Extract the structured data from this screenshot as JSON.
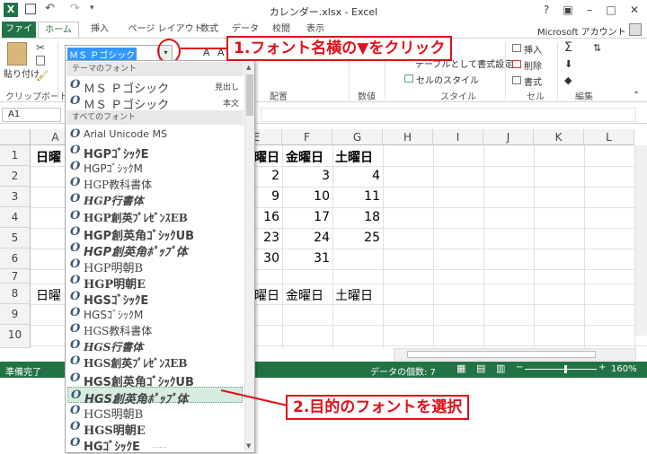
{
  "window": {
    "title": "カレンダー.xlsx - Excel",
    "controls": [
      "?",
      "▣",
      "–",
      "□",
      "✕"
    ]
  },
  "tabs": [
    "ファイル",
    "ホーム",
    "挿入",
    "ページ レイアウト",
    "数式",
    "データ",
    "校閲",
    "表示"
  ],
  "account": "Microsoft アカウント",
  "ribbon": {
    "paste_label": "貼り付け",
    "clipboard_label": "クリップボード",
    "font_box_value": "ＭＳ Ｐゴシック",
    "align_label": "配置",
    "number_label": "数値",
    "table_format": "テーブルとして書式設定",
    "cell_style": "セルのスタイル",
    "style_label": "スタイル",
    "insert": "挿入",
    "delete": "削除",
    "format": "書式",
    "cells_label": "セル",
    "edit_label": "編集"
  },
  "name_box": "A1",
  "columns": [
    "A",
    "B",
    "C",
    "D",
    "E",
    "F",
    "G",
    "H",
    "I",
    "J",
    "K",
    "L"
  ],
  "rows": [
    "1",
    "2",
    "3",
    "4",
    "5",
    "6",
    "7",
    "8",
    "9",
    "10"
  ],
  "cells": {
    "a1": "日曜",
    "e1": "曜日",
    "f1": "金曜日",
    "g1": "土曜日",
    "e2": "2",
    "f2": "3",
    "g2": "4",
    "e3": "9",
    "f3": "10",
    "g3": "11",
    "e4": "16",
    "f4": "17",
    "g4": "18",
    "e5": "23",
    "f5": "24",
    "g5": "25",
    "e6": "30",
    "f6": "31",
    "a8": "日曜",
    "e8": "曜日",
    "f8": "金曜日",
    "g8": "土曜日"
  },
  "dropdown": {
    "theme_header": "テーマのフォント",
    "theme_fonts": [
      {
        "name": "ＭＳ Ｐゴシック",
        "role": "見出し"
      },
      {
        "name": "ＭＳ Ｐゴシック",
        "role": "本文"
      }
    ],
    "all_header": "すべてのフォント",
    "fonts": [
      "Arial Unicode MS",
      "HGPｺﾞｼｯｸE",
      "HGPｺﾞｼｯｸM",
      "HGP教科書体",
      "HGP行書体",
      "HGP創英ﾌﾟﾚｾﾞﾝｽEB",
      "HGP創英角ｺﾞｼｯｸUB",
      "HGP創英角ﾎﾟｯﾌﾟ体",
      "HGP明朝B",
      "HGP明朝E",
      "HGSｺﾞｼｯｸE",
      "HGSｺﾞｼｯｸM",
      "HGS教科書体",
      "HGS行書体",
      "HGS創英ﾌﾟﾚｾﾞﾝｽEB",
      "HGS創英角ｺﾞｼｯｸUB",
      "HGS創英角ﾎﾟｯﾌﾟ体",
      "HGS明朝B",
      "HGS明朝E",
      "HGｺﾞｼｯｸE"
    ],
    "selected_index": 16
  },
  "status": {
    "ready": "準備完了",
    "count": "データの個数: 7",
    "zoom": "160%"
  },
  "callouts": {
    "step1": "1.フォント名横の▼をクリック",
    "step2": "2.目的のフォントを選択"
  },
  "colors": {
    "excel_green": "#217346",
    "callout_red": "#e0101a",
    "selection": "#d8ebe0"
  }
}
